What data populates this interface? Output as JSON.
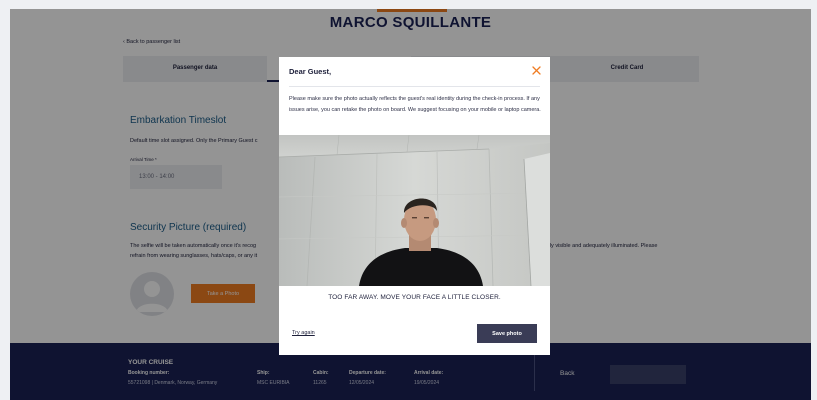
{
  "passenger": {
    "name": "MARCO SQUILLANTE"
  },
  "nav": {
    "back_label": "Back to passenger list"
  },
  "steps": [
    {
      "label": "Passenger data"
    },
    {
      "label": ""
    },
    {
      "label": ""
    },
    {
      "label": "Credit Card"
    }
  ],
  "embarkation": {
    "title": "Embarkation Timeslot",
    "description": "Default time slot assigned. Only the Primary Guest c",
    "arrival_label": "Arrival Time *",
    "arrival_value": "13:00 - 14:00"
  },
  "security": {
    "title": "Security Picture (required)",
    "description_left_1": "The selfie will be taken automatically once it's recog",
    "description_left_2": "refrain from wearing sunglasses, hats/caps, or any it",
    "description_right": "rly visible and adequately illuminated. Please",
    "take_photo_label": "Take a Photo"
  },
  "footer": {
    "title": "YOUR CRUISE",
    "booking_label": "Booking number:",
    "booking_value": "55721098 | Denmark, Norway, Germany",
    "ship_label": "Ship:",
    "ship_value": "MSC EURIBIA",
    "cabin_label": "Cabin:",
    "cabin_value": "11265",
    "departure_label": "Departure date:",
    "departure_value": "12/05/2024",
    "arrival_label": "Arrival date:",
    "arrival_value": "19/05/2024",
    "back_label": "Back",
    "confirm_label": ""
  },
  "modal": {
    "header": "Dear Guest,",
    "body": "Please make sure the photo actually reflects the guest's real identity during the check-in process. If any issues arise, you can retake the photo on board. We suggest focusing on your mobile or laptop camera.",
    "camera_message": "TOO FAR AWAY. MOVE YOUR FACE A LITTLE CLOSER.",
    "try_again_label": "Try again",
    "save_label": "Save photo"
  },
  "colors": {
    "accent": "#f07c22",
    "navy": "#1b2255",
    "section_title": "#1b5c88",
    "save_button": "#3a3c56"
  }
}
